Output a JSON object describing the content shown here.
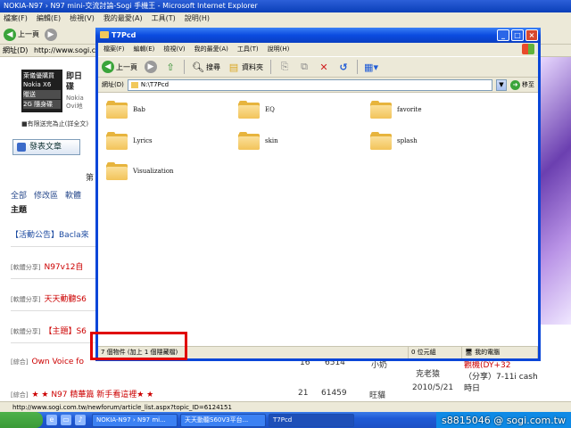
{
  "ie": {
    "title": "NOKIA-N97 › N97 mini-交流討論-Sogi 手機王 - Microsoft Internet Explorer",
    "menu": [
      "檔案(F)",
      "編輯(E)",
      "檢視(V)",
      "我的最愛(A)",
      "工具(T)",
      "說明(H)"
    ],
    "back_label": "上一頁",
    "address_label": "網址(D)",
    "address_url": "http://www.sogi.com",
    "status_url": "http://www.sogi.com.tw/newforum/article_list.aspx?topic_ID=6124151"
  },
  "page": {
    "promo_title": "萊儀優購買",
    "promo_model": "Nokia X6",
    "promo_tag1": "贈送",
    "promo_tag2": "2G 隨身碟",
    "promo_side": "即日",
    "promo_side2": "碟",
    "promo_side3": "Nokia",
    "promo_side4": "Ovi地",
    "promo_note": "■有限送完為止(詳全文)",
    "post_button": "發表文章",
    "pager": "第",
    "tabs": [
      "全部",
      "修改區",
      "軟體"
    ],
    "column_head": "主題",
    "rows": [
      {
        "cat": "",
        "text": "【活動公告】Bacla來"
      },
      {
        "cat": "[軟體分享]",
        "text": "N97v12自"
      },
      {
        "cat": "[軟體分享]",
        "text": "天天動聽S6"
      },
      {
        "cat": "[軟體分享]",
        "text": "【主題】S6"
      },
      {
        "cat": "[綜合]",
        "text": "Own Voice fo"
      },
      {
        "cat": "[綜合]",
        "text": "★ ★ N97 精華篇 新手看這裡★ ★"
      }
    ],
    "row5_cells": [
      "16",
      "6514",
      "小奶",
      "克老猿"
    ],
    "row6_cells": [
      "21",
      "61459",
      "旺貓",
      "2010/5/21"
    ],
    "row5_tail": "我的電腦",
    "right_ad_1": "觀機(DY+32",
    "right_ad_2": "（分享）7-11i cash",
    "right_ad_3": "時日"
  },
  "explorer": {
    "title": "T7Pcd",
    "menu": [
      "檔案(F)",
      "編輯(E)",
      "檢視(V)",
      "我的最愛(A)",
      "工具(T)",
      "說明(H)"
    ],
    "back_label": "上一頁",
    "search_label": "搜尋",
    "folders_label": "資料夾",
    "address_label": "網址(D)",
    "address_value": "N:\\T7Pcd",
    "go_label": "移至",
    "files": [
      {
        "name": "Bab"
      },
      {
        "name": "EQ"
      },
      {
        "name": "favorite"
      },
      {
        "name": "Lyrics"
      },
      {
        "name": "skin"
      },
      {
        "name": "splash"
      },
      {
        "name": "Visualization"
      }
    ],
    "status_left": "7 個物件 (加上 1 個隱藏檔)",
    "status_size": "0 位元組",
    "status_location": "我的電腦"
  },
  "taskbar": {
    "tasks": [
      "NOKIA-N97 › N97 mi...",
      "天天動聽S60V3平台...",
      "T7Pcd"
    ],
    "watermark": "s8815046 @ sogi.com.tw"
  }
}
